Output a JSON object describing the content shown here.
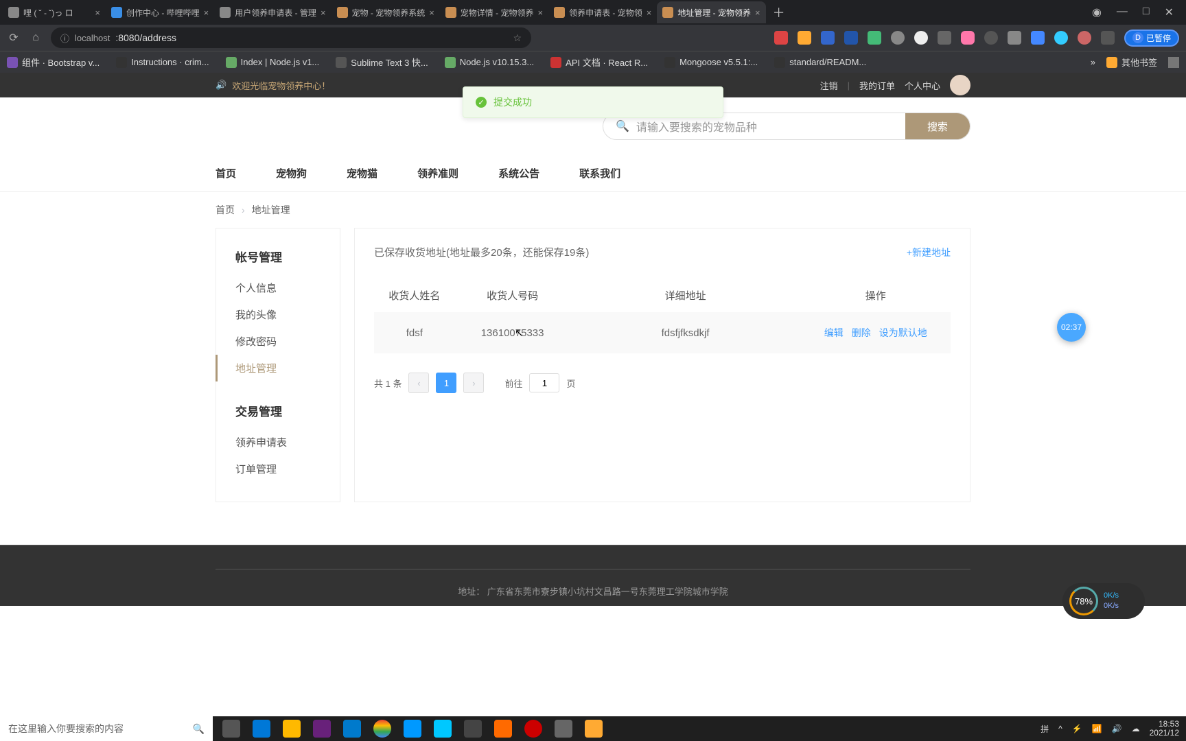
{
  "browser": {
    "tabs": [
      {
        "title": "哩 ( ˘ - ˘)っ ロ",
        "favicon": ""
      },
      {
        "title": "创作中心 - 哔哩哔哩",
        "favicon": "blue"
      },
      {
        "title": "用户领养申请表 - 管理",
        "favicon": ""
      },
      {
        "title": "宠物 - 宠物领养系统",
        "favicon": "orange"
      },
      {
        "title": "宠物详情 - 宠物领养",
        "favicon": "orange"
      },
      {
        "title": "领养申请表 - 宠物领",
        "favicon": "orange"
      },
      {
        "title": "地址管理 - 宠物领养",
        "favicon": "orange",
        "active": true
      }
    ],
    "url_prefix": "localhost",
    "url_path": ":8080/address",
    "pause_label": "已暂停",
    "bookmarks": [
      "组件 · Bootstrap v...",
      "Instructions · crim...",
      "Index | Node.js v1...",
      "Sublime Text 3 快...",
      "Node.js v10.15.3...",
      "API 文档 · React R...",
      "Mongoose v5.5.1:...",
      "standard/READM..."
    ],
    "other_bookmarks": "其他书签"
  },
  "topbar": {
    "welcome": "欢迎光临宠物领养中心！",
    "logout": "注销",
    "orders": "我的订单",
    "profile": "个人中心"
  },
  "toast": {
    "message": "提交成功"
  },
  "search": {
    "placeholder": "请输入要搜索的宠物品种",
    "button": "搜索"
  },
  "nav": [
    "首页",
    "宠物狗",
    "宠物猫",
    "领养准则",
    "系统公告",
    "联系我们"
  ],
  "breadcrumb": {
    "home": "首页",
    "current": "地址管理"
  },
  "sidebar": {
    "group1_title": "帐号管理",
    "group1": [
      "个人信息",
      "我的头像",
      "修改密码",
      "地址管理"
    ],
    "group2_title": "交易管理",
    "group2": [
      "领养申请表",
      "订单管理"
    ]
  },
  "addresses": {
    "title": "已保存收货地址(地址最多20条，还能保存19条)",
    "new_btn": "+新建地址",
    "headers": {
      "name": "收货人姓名",
      "phone": "收货人号码",
      "detail": "详细地址",
      "ops": "操作"
    },
    "rows": [
      {
        "name": "fdsf",
        "phone": "13610075333",
        "detail": "fdsfjfksdkjf"
      }
    ],
    "actions": {
      "edit": "编辑",
      "delete": "删除",
      "default": "设为默认地"
    }
  },
  "pagination": {
    "total": "共 1 条",
    "current": "1",
    "jump_pre": "前往",
    "jump_val": "1",
    "jump_suf": "页"
  },
  "footer": {
    "address": "地址： 广东省东莞市寮步镇小坑村文昌路一号东莞理工学院城市学院"
  },
  "widgets": {
    "timer": "02:37",
    "speed_pct": "78%",
    "speed_up": "0K/s",
    "speed_dn": "0K/s"
  },
  "taskbar": {
    "search_placeholder": "在这里输入你要搜索的内容",
    "ime": "拼",
    "time": "18:53",
    "date": "2021/12"
  }
}
